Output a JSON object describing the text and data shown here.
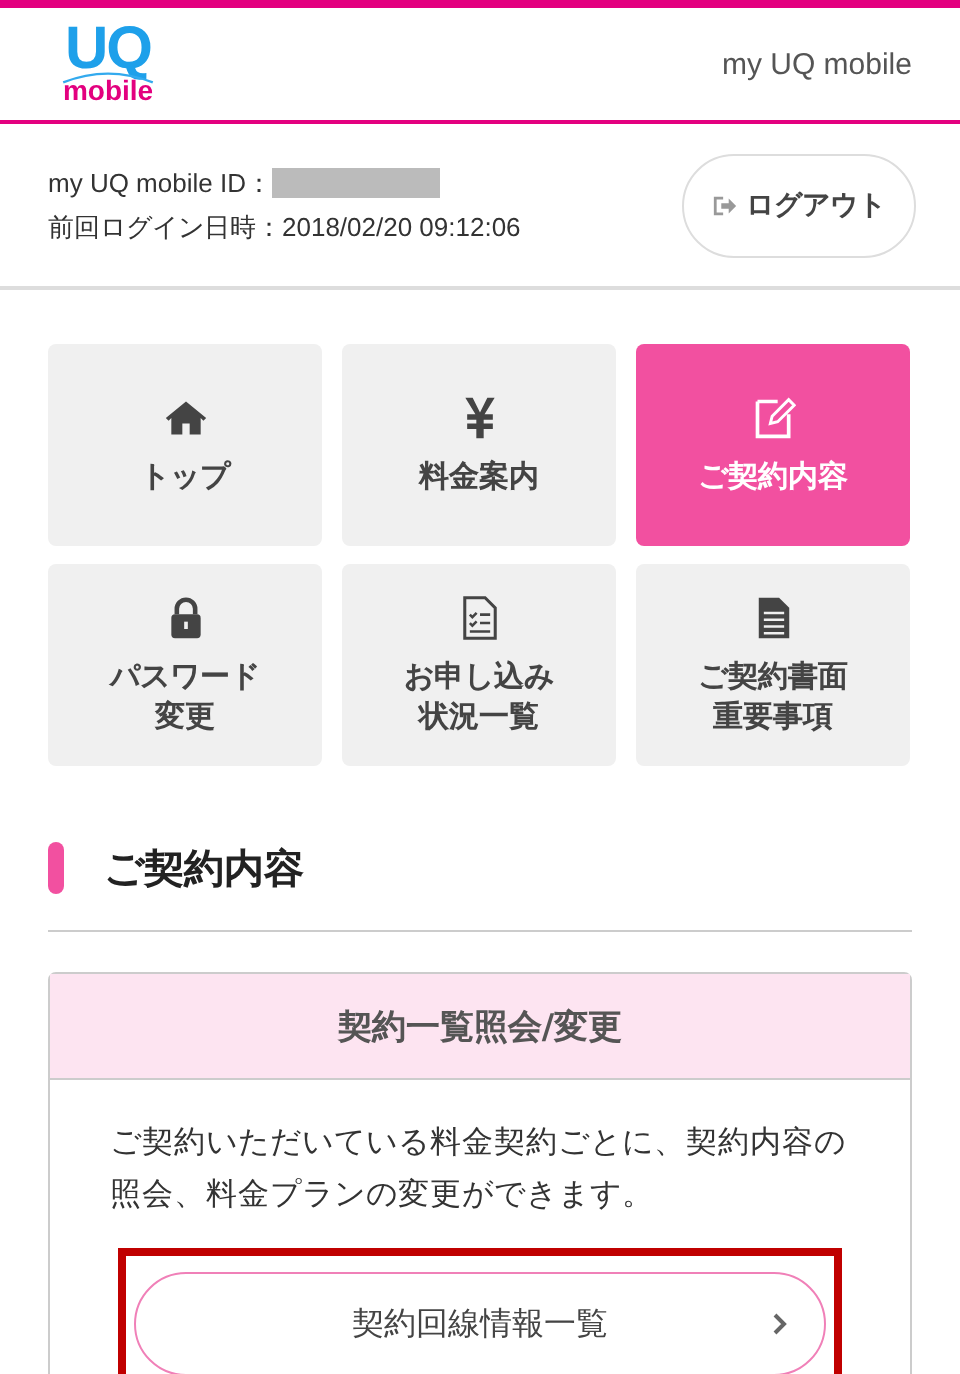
{
  "header": {
    "title": "my UQ mobile",
    "logo": {
      "top": "UQ",
      "bottom": "mobile"
    }
  },
  "account": {
    "id_label": "my UQ mobile ID：",
    "last_login": "前回ログイン日時：2018/02/20 09:12:06",
    "logout": "ログアウト"
  },
  "menu": [
    {
      "lines": [
        "トップ"
      ],
      "selected": false
    },
    {
      "lines": [
        "料金案内"
      ],
      "selected": false
    },
    {
      "lines": [
        "ご契約内容"
      ],
      "selected": true
    },
    {
      "lines": [
        "パスワード",
        "変更"
      ],
      "selected": false
    },
    {
      "lines": [
        "お申し込み",
        "状況一覧"
      ],
      "selected": false
    },
    {
      "lines": [
        "ご契約書面",
        "重要事項"
      ],
      "selected": false
    }
  ],
  "section": {
    "title": "ご契約内容"
  },
  "card": {
    "title": "契約一覧照会/変更",
    "description": "ご契約いただいている料金契約ごとに、契約内容の照会、料金プランの変更ができます。",
    "button": "契約回線情報一覧"
  }
}
